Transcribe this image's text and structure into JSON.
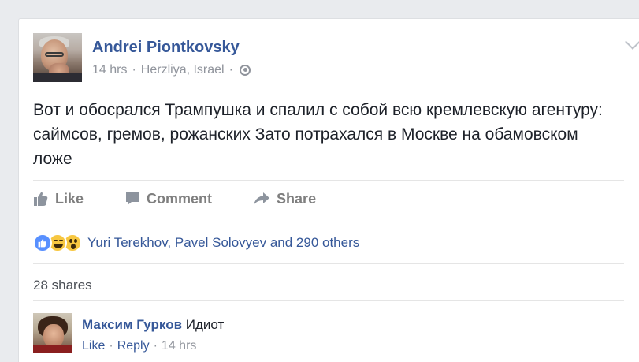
{
  "post": {
    "author": "Andrei Piontkovsky",
    "time": "14 hrs",
    "location": "Herzliya, Israel",
    "separator": "·",
    "text": "Вот и обосрался Трампушка и спалил с собой всю кремлевскую агентуру: саймсов, гремов, рожанских Зато потрахался в Москве на обамовском ложе"
  },
  "actions": {
    "like": "Like",
    "comment": "Comment",
    "share": "Share"
  },
  "reactions": {
    "names": "Yuri Terekhov, Pavel Solovyev and 290 others",
    "icons": [
      "like-icon",
      "haha-icon",
      "wow-icon"
    ]
  },
  "shares": "28 shares",
  "comment": {
    "author": "Максим Гурков",
    "text": "Идиот",
    "like": "Like",
    "reply": "Reply",
    "time": "14 hrs",
    "separator": "·"
  },
  "colors": {
    "link": "#365899",
    "muted": "#90949c",
    "text": "#1d2129",
    "background": "#e9ebee",
    "like_blue": "#5890ff",
    "emoji_yellow": "#f7c741"
  }
}
